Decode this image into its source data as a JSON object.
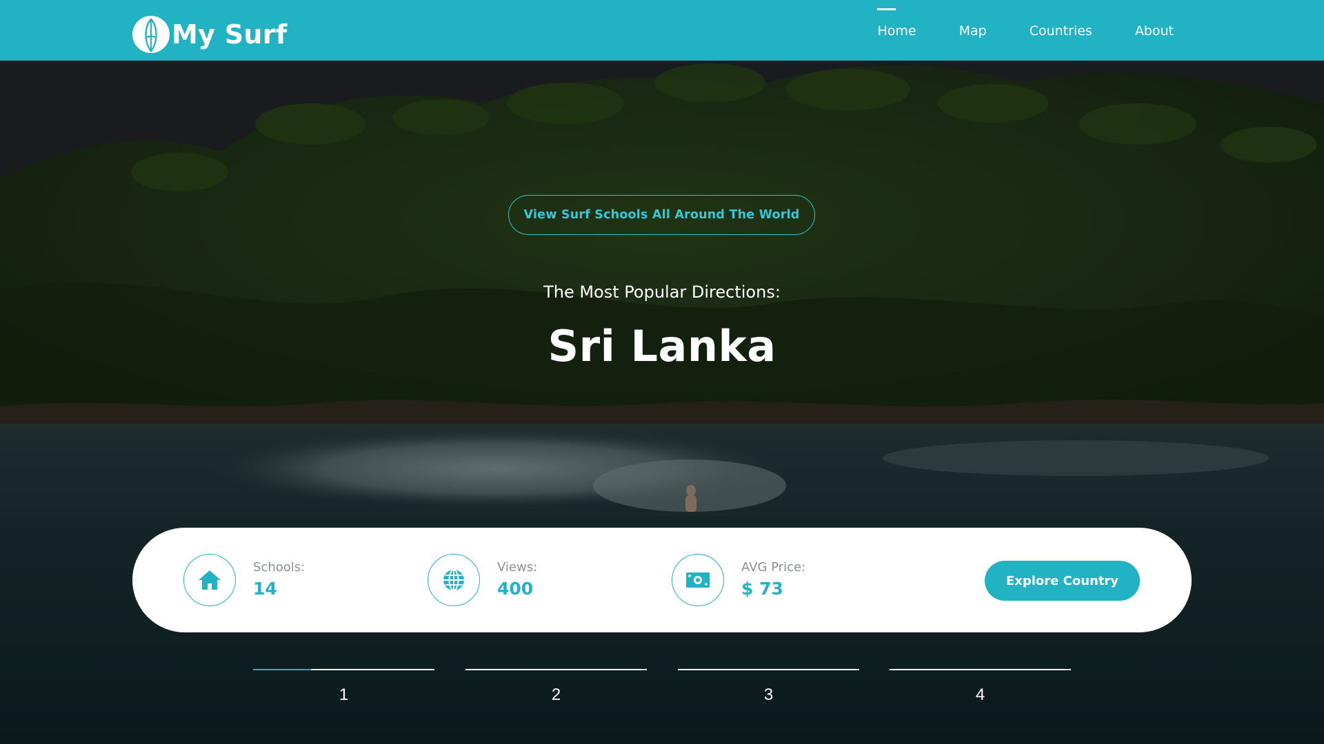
{
  "brand": {
    "name": "My Surf",
    "accent_color": "#21b2c3"
  },
  "nav": {
    "items": [
      {
        "label": "Home",
        "active": true
      },
      {
        "label": "Map",
        "active": false
      },
      {
        "label": "Countries",
        "active": false
      },
      {
        "label": "About",
        "active": false
      }
    ]
  },
  "hero": {
    "cta_label": "View Surf Schools All Around The World",
    "subtitle": "The Most Popular Directions:",
    "title": "Sri Lanka"
  },
  "stats": {
    "schools": {
      "label": "Schools:",
      "value": "14",
      "icon": "house-icon"
    },
    "views": {
      "label": "Views:",
      "value": "400",
      "icon": "globe-icon"
    },
    "avg_price": {
      "label": "AVG Price:",
      "value": "$ 73",
      "icon": "money-icon"
    },
    "explore_label": "Explore Country"
  },
  "pager": {
    "items": [
      {
        "label": "1",
        "progress": 0.32
      },
      {
        "label": "2",
        "progress": 0
      },
      {
        "label": "3",
        "progress": 0
      },
      {
        "label": "4",
        "progress": 0
      }
    ]
  }
}
